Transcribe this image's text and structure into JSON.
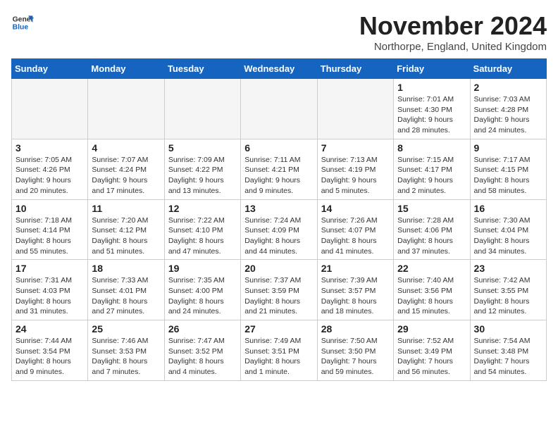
{
  "logo": {
    "line1": "General",
    "line2": "Blue"
  },
  "header": {
    "month": "November 2024",
    "location": "Northorpe, England, United Kingdom"
  },
  "weekdays": [
    "Sunday",
    "Monday",
    "Tuesday",
    "Wednesday",
    "Thursday",
    "Friday",
    "Saturday"
  ],
  "weeks": [
    [
      {
        "day": "",
        "info": ""
      },
      {
        "day": "",
        "info": ""
      },
      {
        "day": "",
        "info": ""
      },
      {
        "day": "",
        "info": ""
      },
      {
        "day": "",
        "info": ""
      },
      {
        "day": "1",
        "info": "Sunrise: 7:01 AM\nSunset: 4:30 PM\nDaylight: 9 hours\nand 28 minutes."
      },
      {
        "day": "2",
        "info": "Sunrise: 7:03 AM\nSunset: 4:28 PM\nDaylight: 9 hours\nand 24 minutes."
      }
    ],
    [
      {
        "day": "3",
        "info": "Sunrise: 7:05 AM\nSunset: 4:26 PM\nDaylight: 9 hours\nand 20 minutes."
      },
      {
        "day": "4",
        "info": "Sunrise: 7:07 AM\nSunset: 4:24 PM\nDaylight: 9 hours\nand 17 minutes."
      },
      {
        "day": "5",
        "info": "Sunrise: 7:09 AM\nSunset: 4:22 PM\nDaylight: 9 hours\nand 13 minutes."
      },
      {
        "day": "6",
        "info": "Sunrise: 7:11 AM\nSunset: 4:21 PM\nDaylight: 9 hours\nand 9 minutes."
      },
      {
        "day": "7",
        "info": "Sunrise: 7:13 AM\nSunset: 4:19 PM\nDaylight: 9 hours\nand 5 minutes."
      },
      {
        "day": "8",
        "info": "Sunrise: 7:15 AM\nSunset: 4:17 PM\nDaylight: 9 hours\nand 2 minutes."
      },
      {
        "day": "9",
        "info": "Sunrise: 7:17 AM\nSunset: 4:15 PM\nDaylight: 8 hours\nand 58 minutes."
      }
    ],
    [
      {
        "day": "10",
        "info": "Sunrise: 7:18 AM\nSunset: 4:14 PM\nDaylight: 8 hours\nand 55 minutes."
      },
      {
        "day": "11",
        "info": "Sunrise: 7:20 AM\nSunset: 4:12 PM\nDaylight: 8 hours\nand 51 minutes."
      },
      {
        "day": "12",
        "info": "Sunrise: 7:22 AM\nSunset: 4:10 PM\nDaylight: 8 hours\nand 47 minutes."
      },
      {
        "day": "13",
        "info": "Sunrise: 7:24 AM\nSunset: 4:09 PM\nDaylight: 8 hours\nand 44 minutes."
      },
      {
        "day": "14",
        "info": "Sunrise: 7:26 AM\nSunset: 4:07 PM\nDaylight: 8 hours\nand 41 minutes."
      },
      {
        "day": "15",
        "info": "Sunrise: 7:28 AM\nSunset: 4:06 PM\nDaylight: 8 hours\nand 37 minutes."
      },
      {
        "day": "16",
        "info": "Sunrise: 7:30 AM\nSunset: 4:04 PM\nDaylight: 8 hours\nand 34 minutes."
      }
    ],
    [
      {
        "day": "17",
        "info": "Sunrise: 7:31 AM\nSunset: 4:03 PM\nDaylight: 8 hours\nand 31 minutes."
      },
      {
        "day": "18",
        "info": "Sunrise: 7:33 AM\nSunset: 4:01 PM\nDaylight: 8 hours\nand 27 minutes."
      },
      {
        "day": "19",
        "info": "Sunrise: 7:35 AM\nSunset: 4:00 PM\nDaylight: 8 hours\nand 24 minutes."
      },
      {
        "day": "20",
        "info": "Sunrise: 7:37 AM\nSunset: 3:59 PM\nDaylight: 8 hours\nand 21 minutes."
      },
      {
        "day": "21",
        "info": "Sunrise: 7:39 AM\nSunset: 3:57 PM\nDaylight: 8 hours\nand 18 minutes."
      },
      {
        "day": "22",
        "info": "Sunrise: 7:40 AM\nSunset: 3:56 PM\nDaylight: 8 hours\nand 15 minutes."
      },
      {
        "day": "23",
        "info": "Sunrise: 7:42 AM\nSunset: 3:55 PM\nDaylight: 8 hours\nand 12 minutes."
      }
    ],
    [
      {
        "day": "24",
        "info": "Sunrise: 7:44 AM\nSunset: 3:54 PM\nDaylight: 8 hours\nand 9 minutes."
      },
      {
        "day": "25",
        "info": "Sunrise: 7:46 AM\nSunset: 3:53 PM\nDaylight: 8 hours\nand 7 minutes."
      },
      {
        "day": "26",
        "info": "Sunrise: 7:47 AM\nSunset: 3:52 PM\nDaylight: 8 hours\nand 4 minutes."
      },
      {
        "day": "27",
        "info": "Sunrise: 7:49 AM\nSunset: 3:51 PM\nDaylight: 8 hours\nand 1 minute."
      },
      {
        "day": "28",
        "info": "Sunrise: 7:50 AM\nSunset: 3:50 PM\nDaylight: 7 hours\nand 59 minutes."
      },
      {
        "day": "29",
        "info": "Sunrise: 7:52 AM\nSunset: 3:49 PM\nDaylight: 7 hours\nand 56 minutes."
      },
      {
        "day": "30",
        "info": "Sunrise: 7:54 AM\nSunset: 3:48 PM\nDaylight: 7 hours\nand 54 minutes."
      }
    ]
  ]
}
